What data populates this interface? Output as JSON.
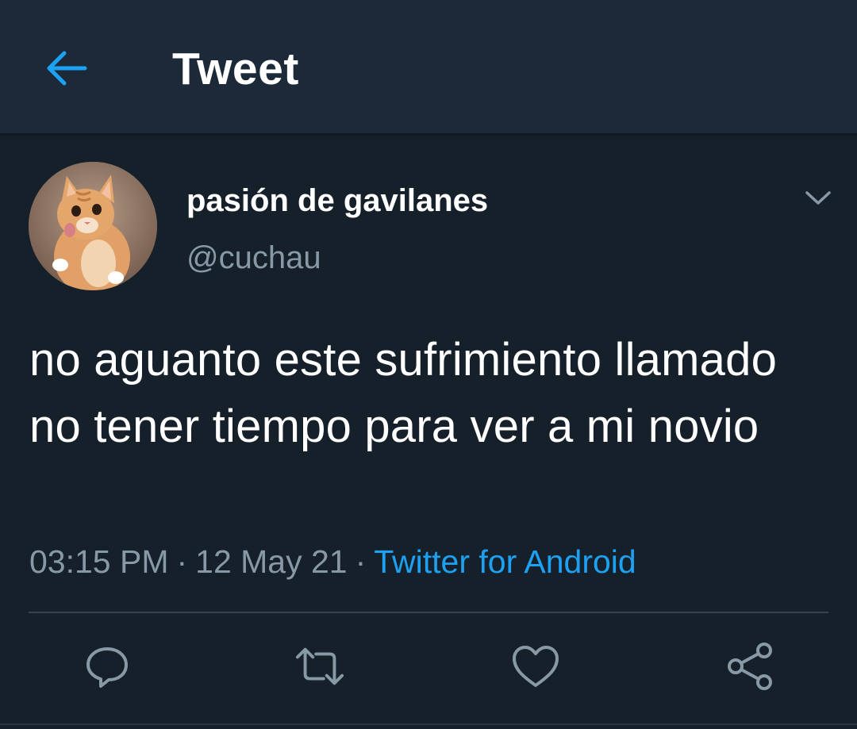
{
  "header": {
    "title": "Tweet",
    "back_icon": "arrow-left-icon",
    "accent_color": "#1da1f2"
  },
  "tweet": {
    "author": {
      "display_name": "pasión de gavilanes",
      "handle": "@cuchau",
      "avatar_icon": "cat-avatar"
    },
    "text": "no aguanto este sufrimiento llamado no tener tiempo para ver a mi novio",
    "time": "03:15 PM",
    "date": "12 May 21",
    "source": "Twitter for Android",
    "separator": "·"
  },
  "actions": [
    {
      "name": "reply",
      "icon": "reply-icon"
    },
    {
      "name": "retweet",
      "icon": "retweet-icon"
    },
    {
      "name": "like",
      "icon": "heart-icon"
    },
    {
      "name": "share",
      "icon": "share-icon"
    }
  ],
  "colors": {
    "background": "#15202b",
    "header_background": "#1c2938",
    "secondary_text": "#8899a6",
    "link": "#1da1f2"
  }
}
